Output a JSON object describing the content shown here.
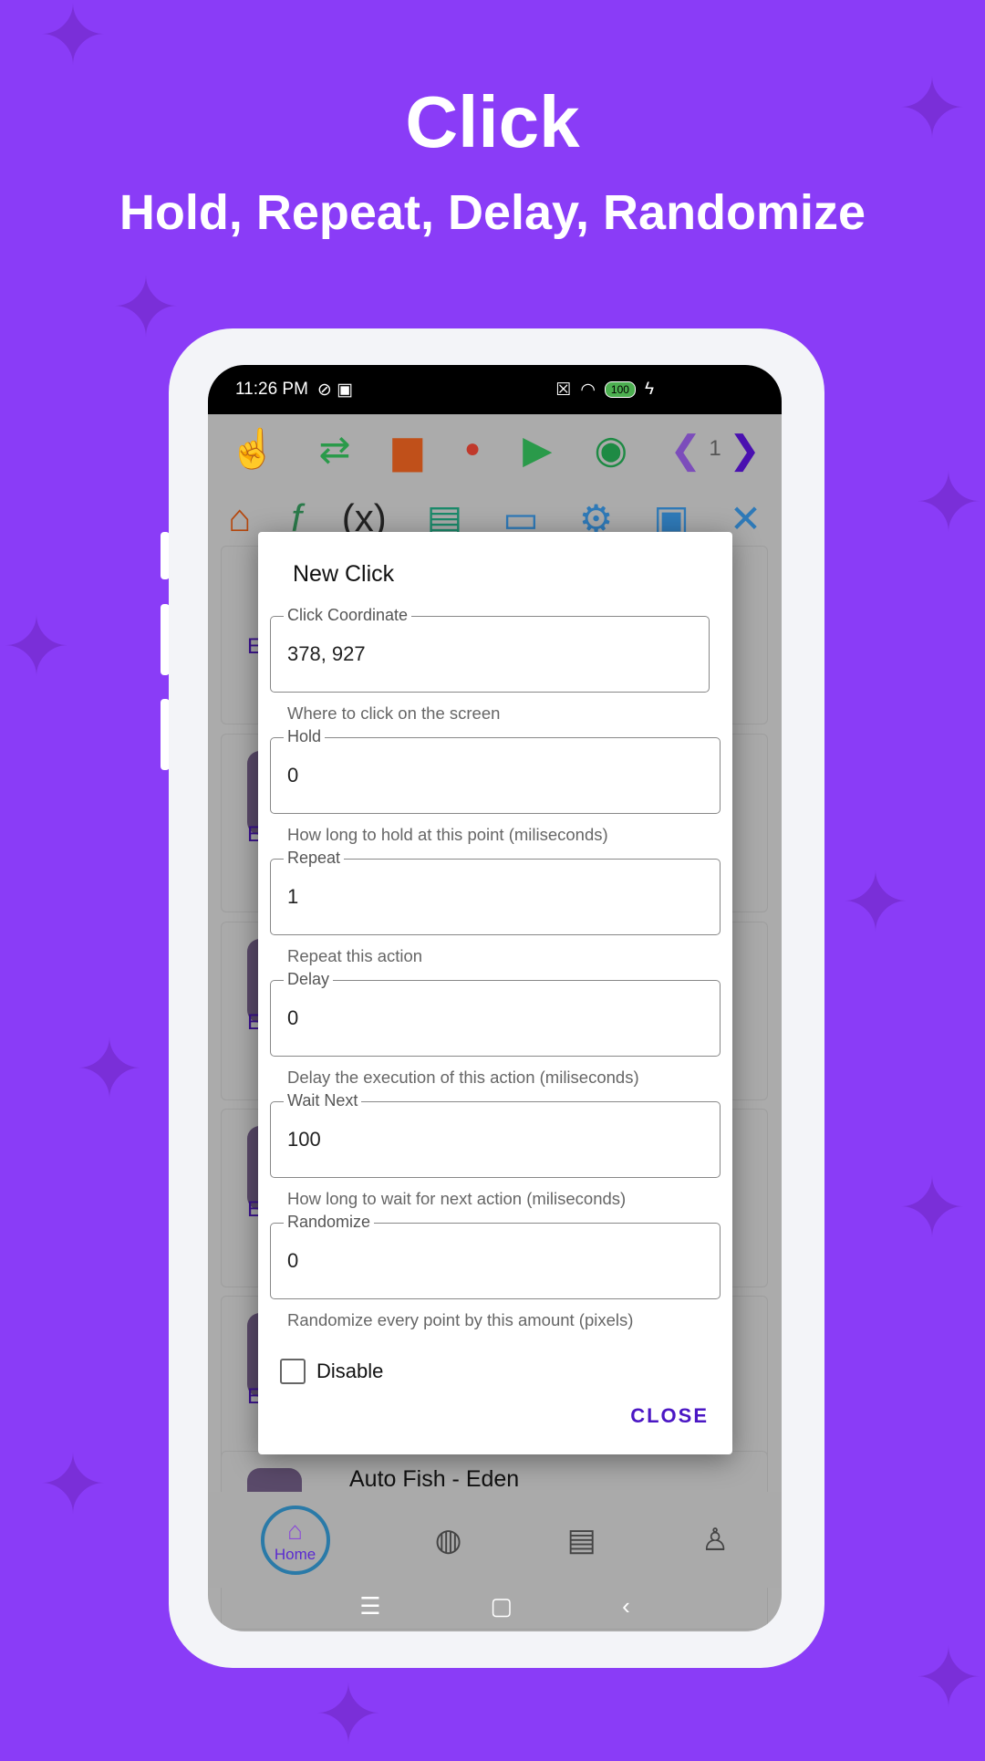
{
  "hero": {
    "title": "Click",
    "subtitle": "Hold, Repeat, Delay, Randomize"
  },
  "status": {
    "time": "11:26 PM",
    "battery": "100"
  },
  "toolbar": {
    "page_number": "1"
  },
  "list": {
    "items": [
      {
        "letter": "E"
      },
      {
        "letter": "E"
      },
      {
        "letter": "E"
      },
      {
        "letter": "E"
      },
      {
        "letter": "E"
      }
    ],
    "last_title": "Auto Fish - Eden"
  },
  "bottom_nav": {
    "home": "Home"
  },
  "dialog": {
    "title": "New Click",
    "fields": [
      {
        "label": "Click Coordinate",
        "value": "378, 927",
        "help": "Where to click on the screen"
      },
      {
        "label": "Hold",
        "value": "0",
        "help": "How long to hold at this point (miliseconds)"
      },
      {
        "label": "Repeat",
        "value": "1",
        "help": "Repeat this action"
      },
      {
        "label": "Delay",
        "value": "0",
        "help": "Delay the execution of this action (miliseconds)"
      },
      {
        "label": "Wait Next",
        "value": "100",
        "help": "How long to wait for next action (miliseconds)"
      },
      {
        "label": "Randomize",
        "value": "0",
        "help": "Randomize every point by this amount (pixels)"
      }
    ],
    "disable_label": "Disable",
    "disable_checked": false,
    "close_label": "CLOSE"
  },
  "colors": {
    "background": "#8a3cf7",
    "accent": "#4b17c4"
  }
}
